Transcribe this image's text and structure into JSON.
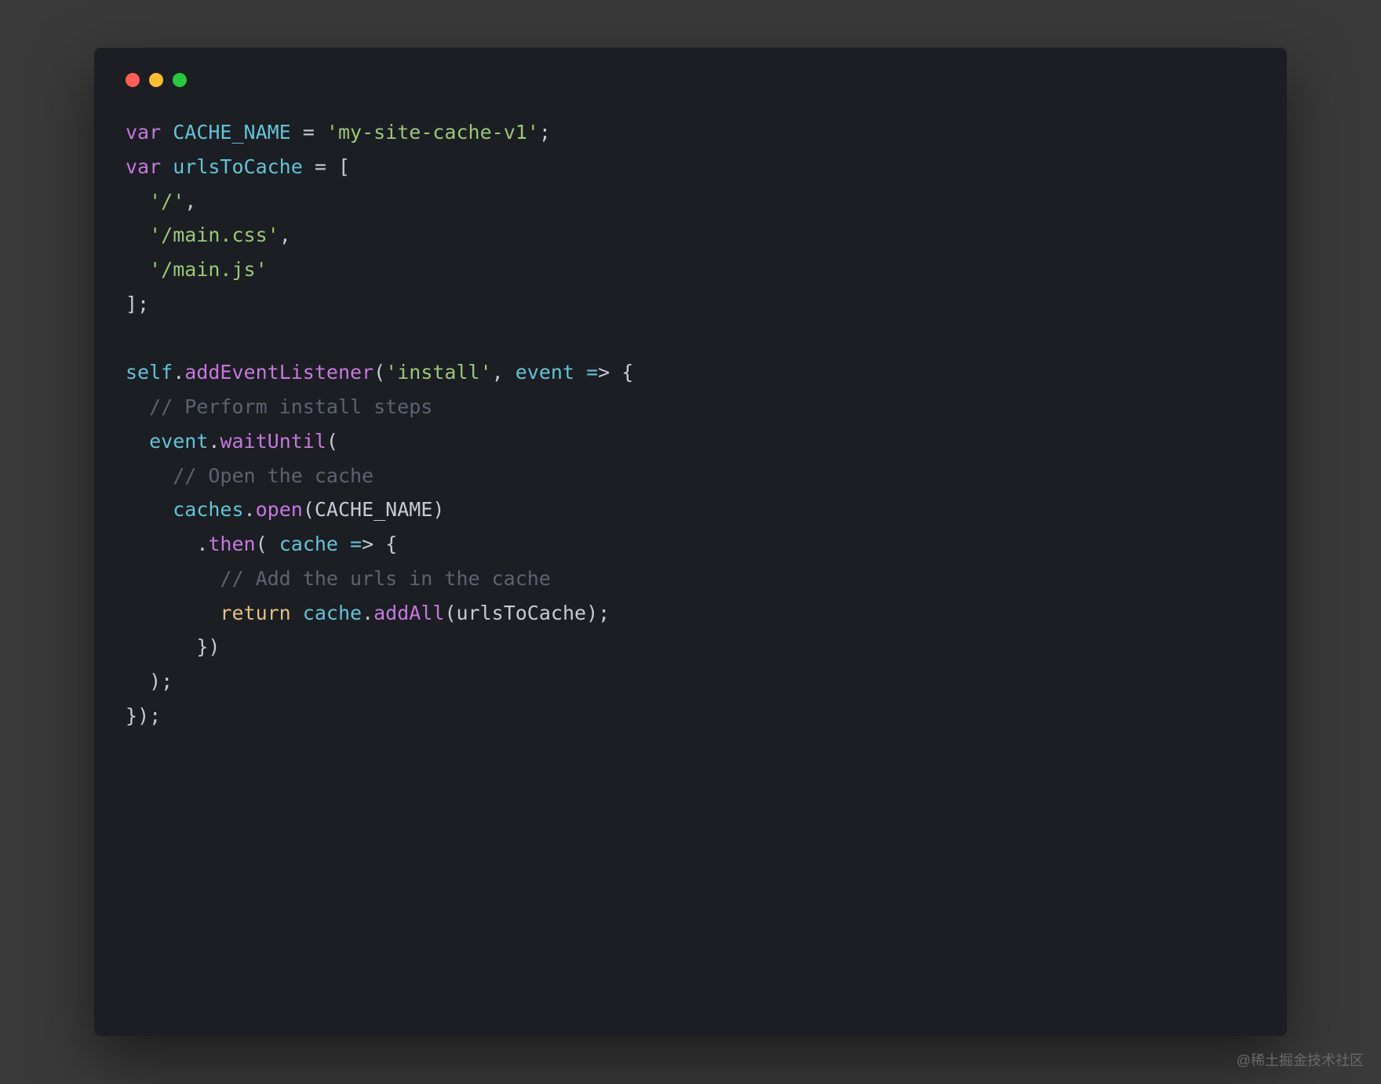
{
  "code": {
    "tokens": [
      {
        "cls": "kw",
        "t": "var"
      },
      {
        "cls": "white",
        "t": " "
      },
      {
        "cls": "var-name",
        "t": "CACHE_NAME"
      },
      {
        "cls": "white",
        "t": " "
      },
      {
        "cls": "op",
        "t": "="
      },
      {
        "cls": "white",
        "t": " "
      },
      {
        "cls": "str",
        "t": "'my-site-cache-v1'"
      },
      {
        "cls": "punct",
        "t": ";"
      },
      {
        "cls": "white",
        "t": "\n"
      },
      {
        "cls": "kw",
        "t": "var"
      },
      {
        "cls": "white",
        "t": " "
      },
      {
        "cls": "var-name",
        "t": "urlsToCache"
      },
      {
        "cls": "white",
        "t": " "
      },
      {
        "cls": "op",
        "t": "="
      },
      {
        "cls": "white",
        "t": " "
      },
      {
        "cls": "punct",
        "t": "["
      },
      {
        "cls": "white",
        "t": "\n"
      },
      {
        "cls": "white",
        "t": "  "
      },
      {
        "cls": "str",
        "t": "'/'"
      },
      {
        "cls": "punct",
        "t": ","
      },
      {
        "cls": "white",
        "t": "\n"
      },
      {
        "cls": "white",
        "t": "  "
      },
      {
        "cls": "str",
        "t": "'/main.css'"
      },
      {
        "cls": "punct",
        "t": ","
      },
      {
        "cls": "white",
        "t": "\n"
      },
      {
        "cls": "white",
        "t": "  "
      },
      {
        "cls": "str",
        "t": "'/main.js'"
      },
      {
        "cls": "white",
        "t": "\n"
      },
      {
        "cls": "punct",
        "t": "];"
      },
      {
        "cls": "white",
        "t": "\n"
      },
      {
        "cls": "white",
        "t": "\n"
      },
      {
        "cls": "var-name",
        "t": "self"
      },
      {
        "cls": "punct",
        "t": "."
      },
      {
        "cls": "fn",
        "t": "addEventListener"
      },
      {
        "cls": "paren",
        "t": "("
      },
      {
        "cls": "str",
        "t": "'install'"
      },
      {
        "cls": "punct",
        "t": ", "
      },
      {
        "cls": "param",
        "t": "event"
      },
      {
        "cls": "white",
        "t": " "
      },
      {
        "cls": "arrow-eq",
        "t": "="
      },
      {
        "cls": "arrow-gt",
        "t": ">"
      },
      {
        "cls": "white",
        "t": " "
      },
      {
        "cls": "punct",
        "t": "{"
      },
      {
        "cls": "white",
        "t": "\n"
      },
      {
        "cls": "white",
        "t": "  "
      },
      {
        "cls": "comment",
        "t": "// Perform install steps"
      },
      {
        "cls": "white",
        "t": "\n"
      },
      {
        "cls": "white",
        "t": "  "
      },
      {
        "cls": "var-name",
        "t": "event"
      },
      {
        "cls": "punct",
        "t": "."
      },
      {
        "cls": "fn",
        "t": "waitUntil"
      },
      {
        "cls": "paren",
        "t": "("
      },
      {
        "cls": "white",
        "t": "\n"
      },
      {
        "cls": "white",
        "t": "    "
      },
      {
        "cls": "comment",
        "t": "// Open the cache"
      },
      {
        "cls": "white",
        "t": "\n"
      },
      {
        "cls": "white",
        "t": "    "
      },
      {
        "cls": "var-name",
        "t": "caches"
      },
      {
        "cls": "punct",
        "t": "."
      },
      {
        "cls": "fn",
        "t": "open"
      },
      {
        "cls": "paren",
        "t": "("
      },
      {
        "cls": "white",
        "t": "CACHE_NAME"
      },
      {
        "cls": "paren",
        "t": ")"
      },
      {
        "cls": "white",
        "t": "\n"
      },
      {
        "cls": "white",
        "t": "      "
      },
      {
        "cls": "punct",
        "t": "."
      },
      {
        "cls": "fn",
        "t": "then"
      },
      {
        "cls": "paren",
        "t": "("
      },
      {
        "cls": "white",
        "t": " "
      },
      {
        "cls": "param",
        "t": "cache"
      },
      {
        "cls": "white",
        "t": " "
      },
      {
        "cls": "arrow-eq",
        "t": "="
      },
      {
        "cls": "arrow-gt",
        "t": ">"
      },
      {
        "cls": "white",
        "t": " "
      },
      {
        "cls": "punct",
        "t": "{"
      },
      {
        "cls": "white",
        "t": "\n"
      },
      {
        "cls": "white",
        "t": "        "
      },
      {
        "cls": "comment",
        "t": "// Add the urls in the cache"
      },
      {
        "cls": "white",
        "t": "\n"
      },
      {
        "cls": "white",
        "t": "        "
      },
      {
        "cls": "ret",
        "t": "return"
      },
      {
        "cls": "white",
        "t": " "
      },
      {
        "cls": "var-name",
        "t": "cache"
      },
      {
        "cls": "punct",
        "t": "."
      },
      {
        "cls": "fn",
        "t": "addAll"
      },
      {
        "cls": "paren",
        "t": "("
      },
      {
        "cls": "white",
        "t": "urlsToCache"
      },
      {
        "cls": "paren",
        "t": ")"
      },
      {
        "cls": "punct",
        "t": ";"
      },
      {
        "cls": "white",
        "t": "\n"
      },
      {
        "cls": "white",
        "t": "      "
      },
      {
        "cls": "punct",
        "t": "}"
      },
      {
        "cls": "paren",
        "t": ")"
      },
      {
        "cls": "white",
        "t": "\n"
      },
      {
        "cls": "white",
        "t": "  "
      },
      {
        "cls": "paren",
        "t": ")"
      },
      {
        "cls": "punct",
        "t": ";"
      },
      {
        "cls": "white",
        "t": "\n"
      },
      {
        "cls": "punct",
        "t": "}"
      },
      {
        "cls": "paren",
        "t": ")"
      },
      {
        "cls": "punct",
        "t": ";"
      }
    ]
  },
  "watermark": "@稀土掘金技术社区"
}
